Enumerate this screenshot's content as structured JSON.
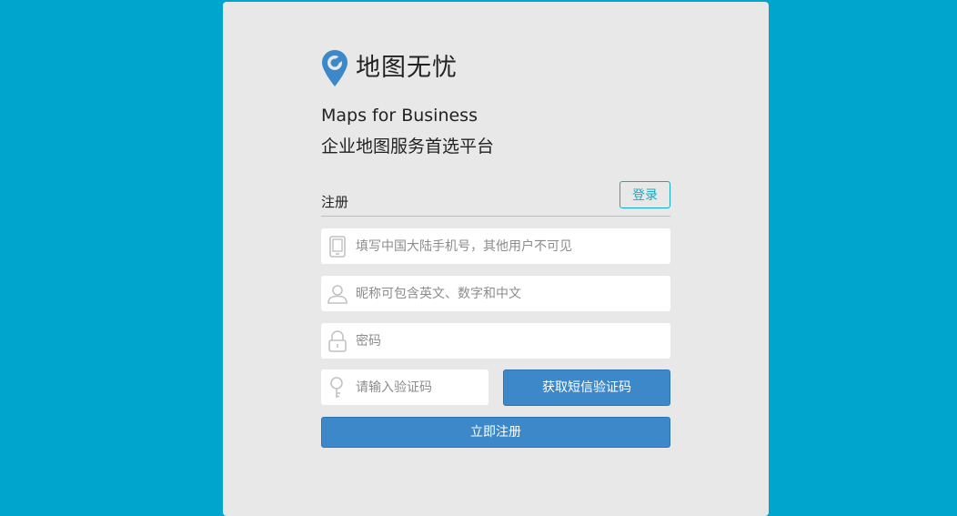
{
  "brand": {
    "name": "地图无忧",
    "logo_icon": "map-pin-icon",
    "accent": "#3d88c8"
  },
  "tagline": {
    "line1": "Maps for Business",
    "line2": "企业地图服务首选平台"
  },
  "tabs": {
    "register": "注册",
    "login": "登录"
  },
  "form": {
    "phone": {
      "placeholder": "填写中国大陆手机号，其他用户不可见",
      "icon": "phone-icon"
    },
    "nickname": {
      "placeholder": "昵称可包含英文、数字和中文",
      "icon": "user-icon"
    },
    "password": {
      "placeholder": "密码",
      "icon": "lock-icon"
    },
    "code": {
      "placeholder": "请输入验证码",
      "icon": "key-icon"
    },
    "sms_button": "获取短信验证码",
    "submit_button": "立即注册"
  },
  "colors": {
    "background": "#00a5cd",
    "card": "#e8e8e8",
    "button": "#3d88c8",
    "login_border": "#16a9c6"
  }
}
